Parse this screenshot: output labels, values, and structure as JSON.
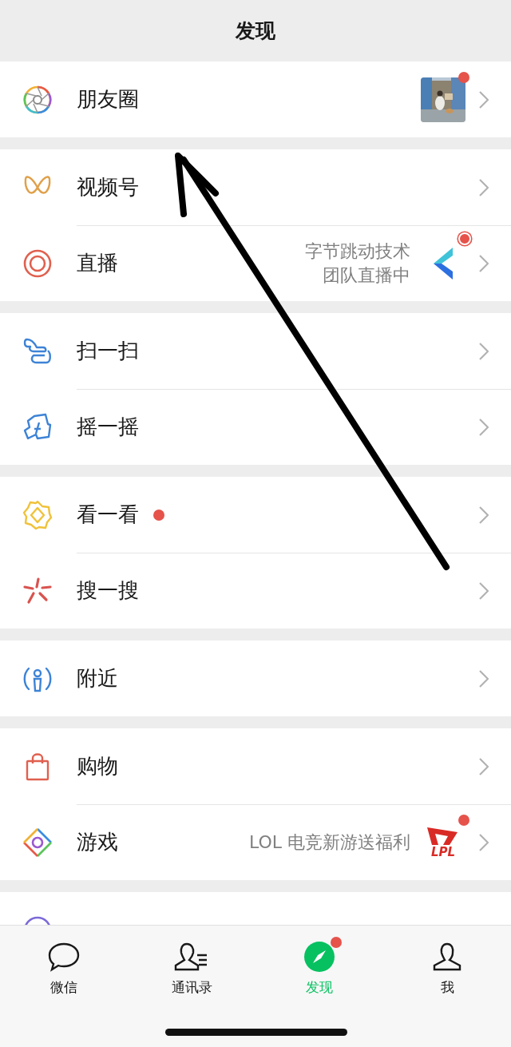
{
  "header": {
    "title": "发现"
  },
  "groups": [
    {
      "items": [
        {
          "label": "朋友圈",
          "dot": false,
          "preview": {
            "kind": "picture",
            "badge": true,
            "live": false
          }
        }
      ]
    },
    {
      "items": [
        {
          "label": "视频号",
          "dot": false
        },
        {
          "label": "直播",
          "dot": false,
          "detail": "字节跳动技术团队直播中",
          "preview": {
            "kind": "logo",
            "badge": false,
            "live": true
          }
        }
      ]
    },
    {
      "items": [
        {
          "label": "扫一扫",
          "dot": false
        },
        {
          "label": "摇一摇",
          "dot": false
        }
      ]
    },
    {
      "items": [
        {
          "label": "看一看",
          "dot": true
        },
        {
          "label": "搜一搜",
          "dot": false
        }
      ]
    },
    {
      "items": [
        {
          "label": "附近",
          "dot": false
        }
      ]
    },
    {
      "items": [
        {
          "label": "购物",
          "dot": false
        },
        {
          "label": "游戏",
          "dot": false,
          "detail": "LOL 电竞新游送福利",
          "preview": {
            "kind": "logo",
            "text": "LPL",
            "badge": true,
            "live": false
          }
        }
      ]
    },
    {
      "items": [
        {
          "kind": "clipped"
        }
      ]
    }
  ],
  "tabs": [
    {
      "label": "微信",
      "selected": false,
      "badge": false
    },
    {
      "label": "通讯录",
      "selected": false,
      "badge": false
    },
    {
      "label": "发现",
      "selected": true,
      "badge": true
    },
    {
      "label": "我",
      "selected": false,
      "badge": false
    }
  ]
}
